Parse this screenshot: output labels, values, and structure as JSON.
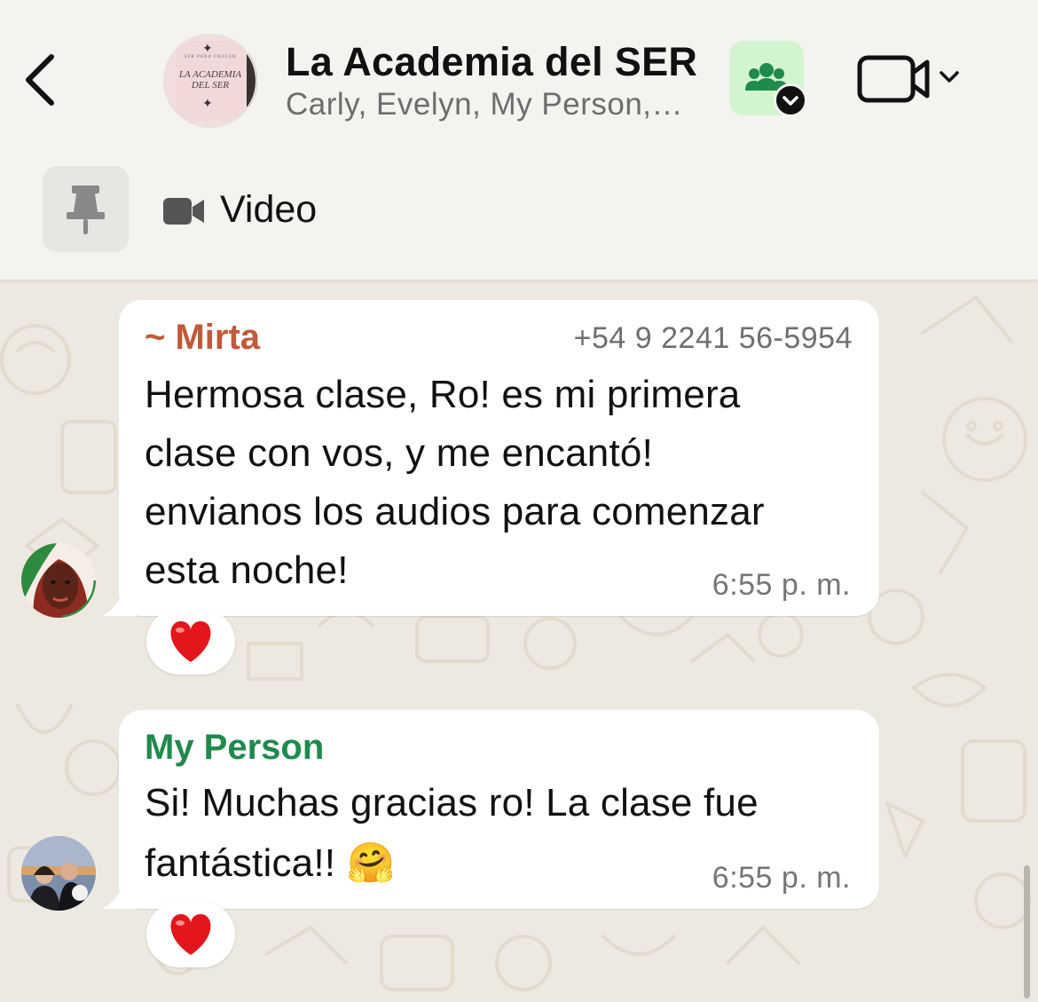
{
  "header": {
    "title": "La Academia del SER",
    "subtitle": "Carly, Evelyn, My Person,…",
    "avatar": {
      "small_text": "SER PARA CRECER",
      "text": "LA ACADEMIA\nDEL SER"
    },
    "back_icon": "chevron-left-icon",
    "community_icon": "group-icon",
    "video_call_icon": "video-camera-icon"
  },
  "pinned": {
    "label": "Video",
    "icon": "video-camera-icon"
  },
  "messages": [
    {
      "sender": "~ Mirta",
      "sender_color": "#c05a38",
      "phone": "+54 9 2241 56-5954",
      "lines": [
        "Hermosa clase, Ro! es mi primera",
        "clase con vos, y me encantó!",
        "envianos los audios para comenzar",
        "esta noche!"
      ],
      "time": "6:55 p. m.",
      "reaction": "❤️"
    },
    {
      "sender": "My Person",
      "sender_color": "#1f8a4c",
      "lines": [
        "Si! Muchas gracias ro! La clase fue",
        "fantástica!! 🤗"
      ],
      "time": "6:55 p. m.",
      "reaction": "❤️"
    }
  ],
  "colors": {
    "header_bg": "#f4f3ef",
    "chat_bg": "#eee9e0",
    "community_button_bg": "#d2f5cf",
    "bubble_bg": "#ffffff"
  }
}
